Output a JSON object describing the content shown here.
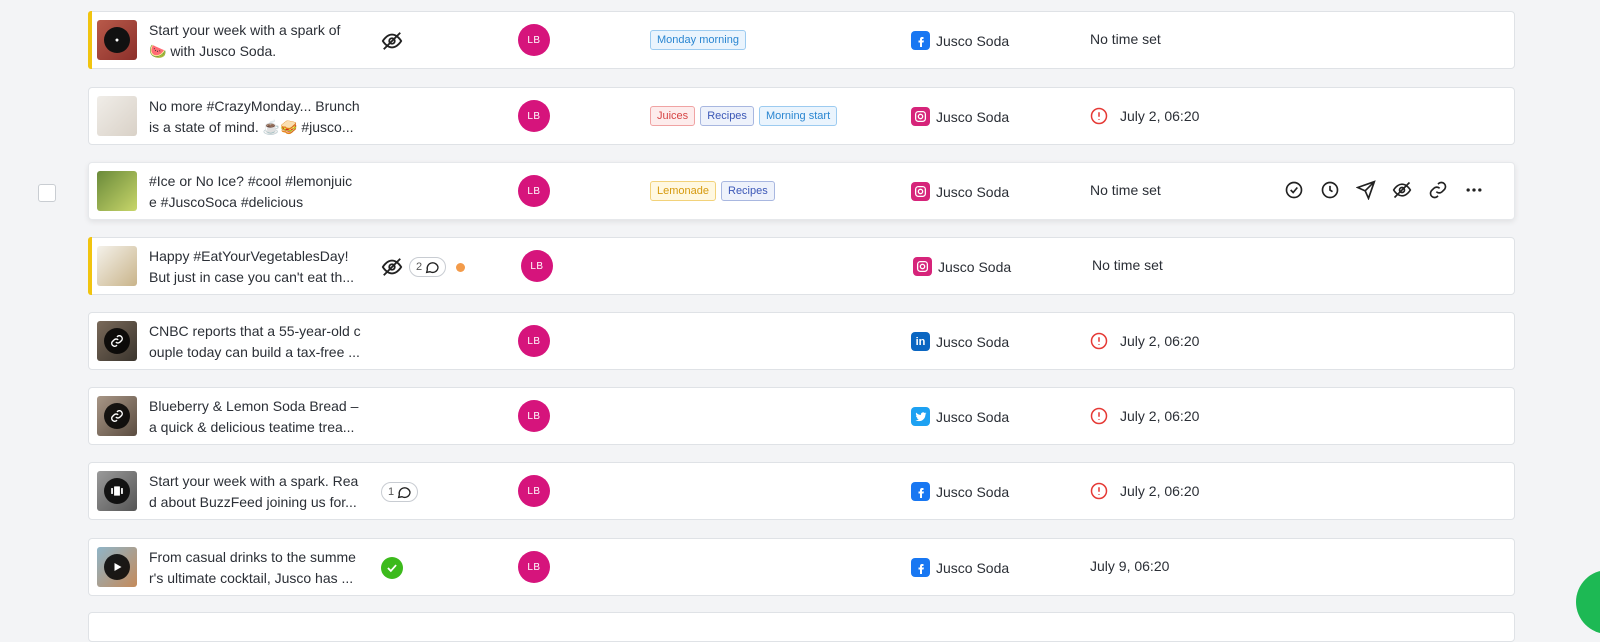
{
  "rows": [
    {
      "title_1": "Start your week with a spark of",
      "title_2": "🍉 with Jusco Soda.",
      "avatar": "LB",
      "tags": [
        "Monday morning"
      ],
      "network": "facebook",
      "account": "Jusco Soda",
      "time": "No time set",
      "status": "hidden",
      "flag": true
    },
    {
      "title_1": "No more #CrazyMonday... Brunch",
      "title_2": "is a state of mind. ☕🥪 #jusco...",
      "avatar": "LB",
      "tags": [
        "Juices",
        "Recipes",
        "Morning start"
      ],
      "network": "instagram",
      "account": "Jusco Soda",
      "time": "July 2, 06:20",
      "status": "",
      "flag": false
    },
    {
      "title_1": "#Ice or No Ice? #cool #lemonjuic",
      "title_2": "e #JuscoSoca #delicious",
      "avatar": "LB",
      "tags": [
        "Lemonade",
        "Recipes"
      ],
      "network": "instagram",
      "account": "Jusco Soda",
      "time": "No time set",
      "status": "",
      "flag": false
    },
    {
      "title_1": "Happy #EatYourVegetablesDay!",
      "title_2": "But just in case you can't eat th...",
      "avatar": "LB",
      "tags": [],
      "network": "instagram",
      "account": "Jusco Soda",
      "time": "No time set",
      "status": "hidden-comments",
      "comments": "2",
      "flag": true
    },
    {
      "title_1": "CNBC reports that a 55-year-old c",
      "title_2": "ouple today can build a tax-free ...",
      "avatar": "LB",
      "tags": [],
      "network": "linkedin",
      "account": "Jusco Soda",
      "time": "July 2, 06:20",
      "status": "",
      "flag": false
    },
    {
      "title_1": "Blueberry & Lemon Soda Bread –",
      "title_2": "a quick & delicious teatime trea...",
      "avatar": "LB",
      "tags": [],
      "network": "twitter",
      "account": "Jusco Soda",
      "time": "July 2, 06:20",
      "status": "",
      "flag": false
    },
    {
      "title_1": "Start your week with a spark. Rea",
      "title_2": "d about BuzzFeed joining us for...",
      "avatar": "LB",
      "tags": [],
      "network": "facebook",
      "account": "Jusco Soda",
      "time": "July 2, 06:20",
      "status": "comments",
      "comments": "1",
      "flag": false
    },
    {
      "title_1": "From casual drinks to the summe",
      "title_2": "r's ultimate cocktail, Jusco has ...",
      "avatar": "LB",
      "tags": [],
      "network": "facebook",
      "account": "Jusco Soda",
      "time": "July 9, 06:20",
      "status": "approved",
      "flag": false
    }
  ],
  "colors": {
    "accent_avatar": "#d6147c",
    "flag": "#f1c40f",
    "warn": "#e53935",
    "approved": "#3cba1c"
  }
}
